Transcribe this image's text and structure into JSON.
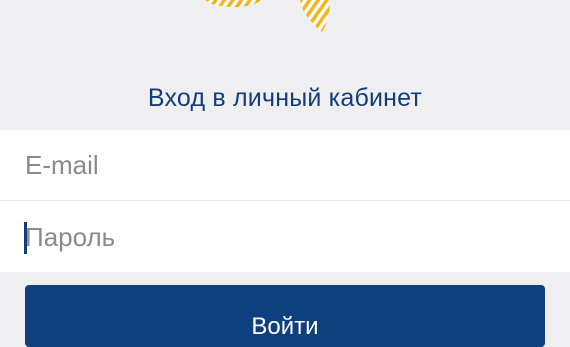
{
  "header": {
    "logo_icon": "brand-logo-icon",
    "logo_color": "#f2b515"
  },
  "login": {
    "title": "Вход в личный кабинет",
    "email_placeholder": "E-mail",
    "password_placeholder": "Пароль",
    "submit_label": "Войти"
  },
  "colors": {
    "title": "#123d7a",
    "button_bg": "#0e3f7e",
    "button_text": "#ffffff",
    "page_bg": "#efeff2",
    "field_bg": "#ffffff"
  }
}
